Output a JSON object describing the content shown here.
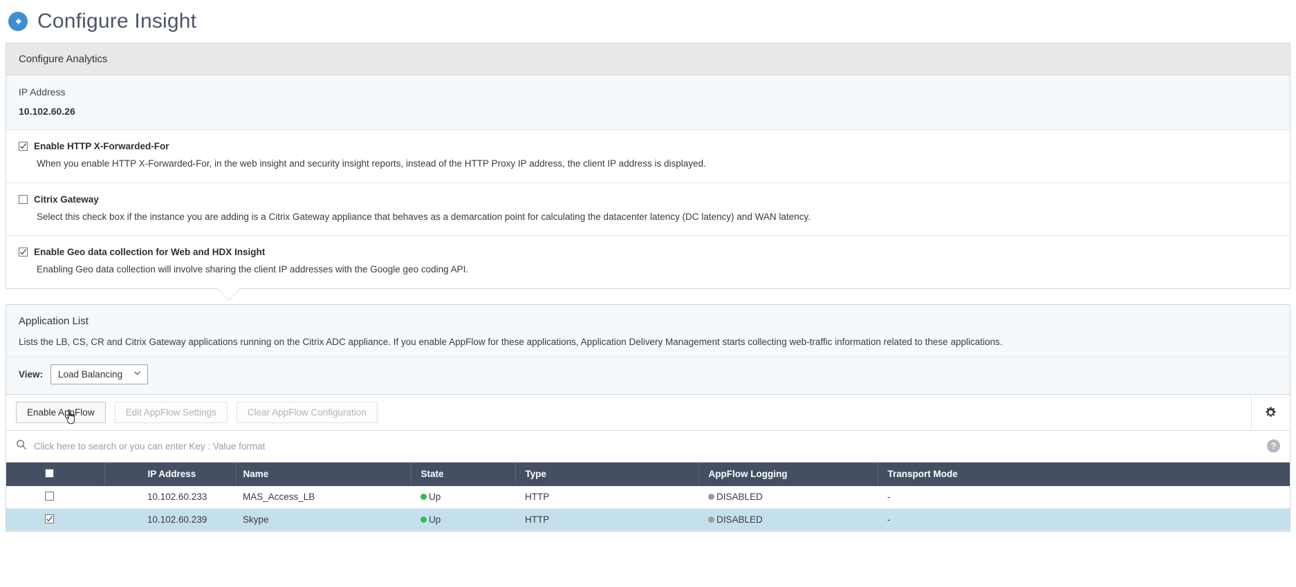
{
  "header": {
    "back_icon": "back-arrow-icon",
    "title": "Configure Insight"
  },
  "analytics_panel": {
    "title": "Configure Analytics",
    "ip_field": {
      "label": "IP Address",
      "value": "10.102.60.26"
    },
    "options": [
      {
        "label": "Enable HTTP X-Forwarded-For",
        "checked": true,
        "description": "When you enable HTTP X-Forwarded-For, in the web insight and security insight reports, instead of the HTTP Proxy IP address, the client IP address is displayed."
      },
      {
        "label": "Citrix Gateway",
        "checked": false,
        "description": "Select this check box if the instance you are adding is a Citrix Gateway appliance that behaves as a demarcation point for calculating the datacenter latency (DC latency) and WAN latency."
      },
      {
        "label": "Enable Geo data collection for Web and HDX Insight",
        "checked": true,
        "description": "Enabling Geo data collection will involve sharing the client IP addresses with the Google geo coding API."
      }
    ]
  },
  "application_list": {
    "title": "Application List",
    "description": "Lists the LB, CS, CR and Citrix Gateway applications running on the Citrix ADC appliance. If you enable AppFlow for these applications, Application Delivery Management starts collecting web-traffic information related to these applications.",
    "view": {
      "label": "View:",
      "selected": "Load Balancing",
      "chevron_icon": "chevron-down-icon"
    },
    "toolbar": {
      "enable_appflow": "Enable AppFlow",
      "edit_appflow_settings": "Edit AppFlow Settings",
      "clear_appflow_configuration": "Clear AppFlow Configuration",
      "settings_icon": "gear-icon"
    },
    "search": {
      "icon": "search-icon",
      "placeholder": "Click here to search or you can enter Key : Value format",
      "help_icon": "help-icon",
      "help_label": "?"
    },
    "table": {
      "columns": [
        "",
        "IP Address",
        "Name",
        "State",
        "Type",
        "AppFlow Logging",
        "Transport Mode"
      ],
      "rows": [
        {
          "selected": false,
          "checked": false,
          "ip_address": "10.102.60.233",
          "name": "MAS_Access_LB",
          "state": "Up",
          "state_status": "up",
          "type": "HTTP",
          "appflow_logging": "DISABLED",
          "appflow_status": "disabled",
          "transport_mode": "-"
        },
        {
          "selected": true,
          "checked": true,
          "ip_address": "10.102.60.239",
          "name": "Skype",
          "state": "Up",
          "state_status": "up",
          "type": "HTTP",
          "appflow_logging": "DISABLED",
          "appflow_status": "disabled",
          "transport_mode": "-"
        }
      ]
    }
  },
  "colors": {
    "accent_blue": "#3d8fd1",
    "table_header": "#454f63",
    "row_selected": "#c5e0ed",
    "status_up": "#2fbf4c",
    "status_disabled": "#9b9b9b",
    "panel_tint": "#f5f9fc"
  }
}
